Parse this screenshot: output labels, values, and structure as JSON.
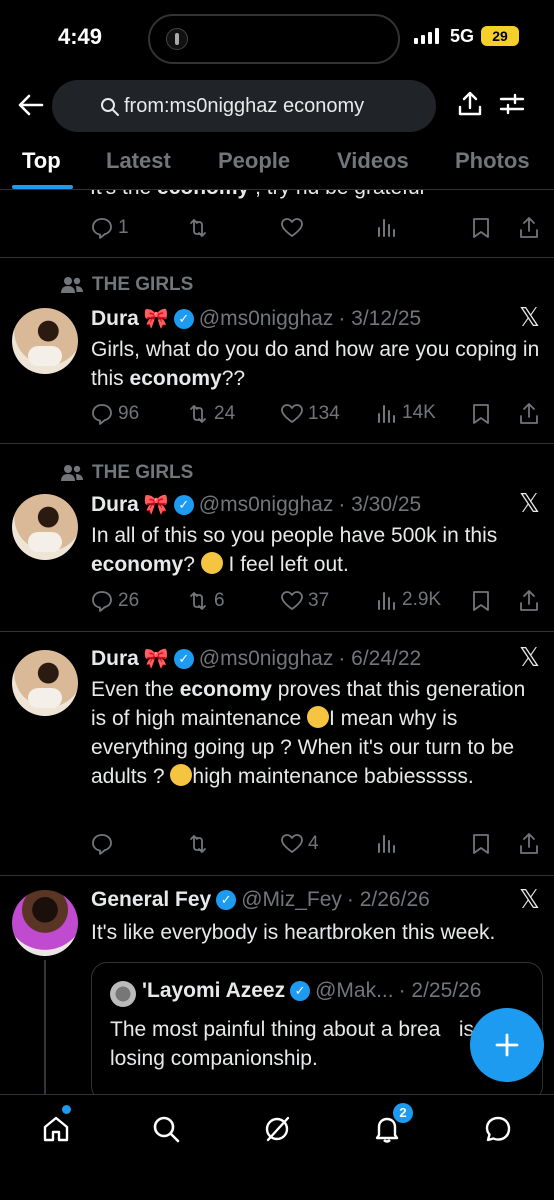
{
  "status_bar": {
    "time": "4:49",
    "network": "5G",
    "battery": "29"
  },
  "search": {
    "query": "from:ms0nigghaz economy"
  },
  "tabs": [
    {
      "label": "Top",
      "active": true
    },
    {
      "label": "Latest",
      "active": false
    },
    {
      "label": "People",
      "active": false
    },
    {
      "label": "Videos",
      "active": false
    },
    {
      "label": "Photos",
      "active": false
    }
  ],
  "partial_tweet": {
    "text_before": "It's the ",
    "text_bold": "economy",
    "text_after": " , try nd be grateful",
    "replies": "1"
  },
  "tweets": [
    {
      "context": "THE GIRLS",
      "name": "Dura",
      "handle": "@ms0nigghaz",
      "date": "· 3/12/25",
      "text_1": "Girls, what do you do and how are you coping in this ",
      "text_bold": "economy",
      "text_2": "??",
      "replies": "96",
      "reposts": "24",
      "likes": "134",
      "views": "14K"
    },
    {
      "context": "THE GIRLS",
      "name": "Dura",
      "handle": "@ms0nigghaz",
      "date": "· 3/30/25",
      "text_1": "In all of this so you people have 500k in this ",
      "text_bold": "economy",
      "text_2": "? ",
      "text_3": " I feel left out.",
      "replies": "26",
      "reposts": "6",
      "likes": "37",
      "views": "2.9K"
    },
    {
      "name": "Dura",
      "handle": "@ms0nigghaz",
      "date": "· 6/24/22",
      "text_1": "Even the ",
      "text_bold": "economy",
      "text_2": " proves that this generation is of high maintenance ",
      "text_3": "I mean why is everything going up ? When it's our turn to be adults ? ",
      "text_4": "high maintenance babiesssss.",
      "likes": "4"
    },
    {
      "name": "General Fey",
      "handle": "@Miz_Fey",
      "date": "· 2/26/26",
      "text": "It's like everybody is heartbroken this week."
    }
  ],
  "quote": {
    "name": "'Layomi Azeez",
    "handle": "@Mak...",
    "date": "· 2/25/26",
    "text": "The most painful thing about a brea    is losing companionship."
  },
  "nav": {
    "notifications_badge": "2"
  },
  "colors": {
    "accent": "#1d9bf0",
    "background": "#000000",
    "muted": "#71767b"
  }
}
